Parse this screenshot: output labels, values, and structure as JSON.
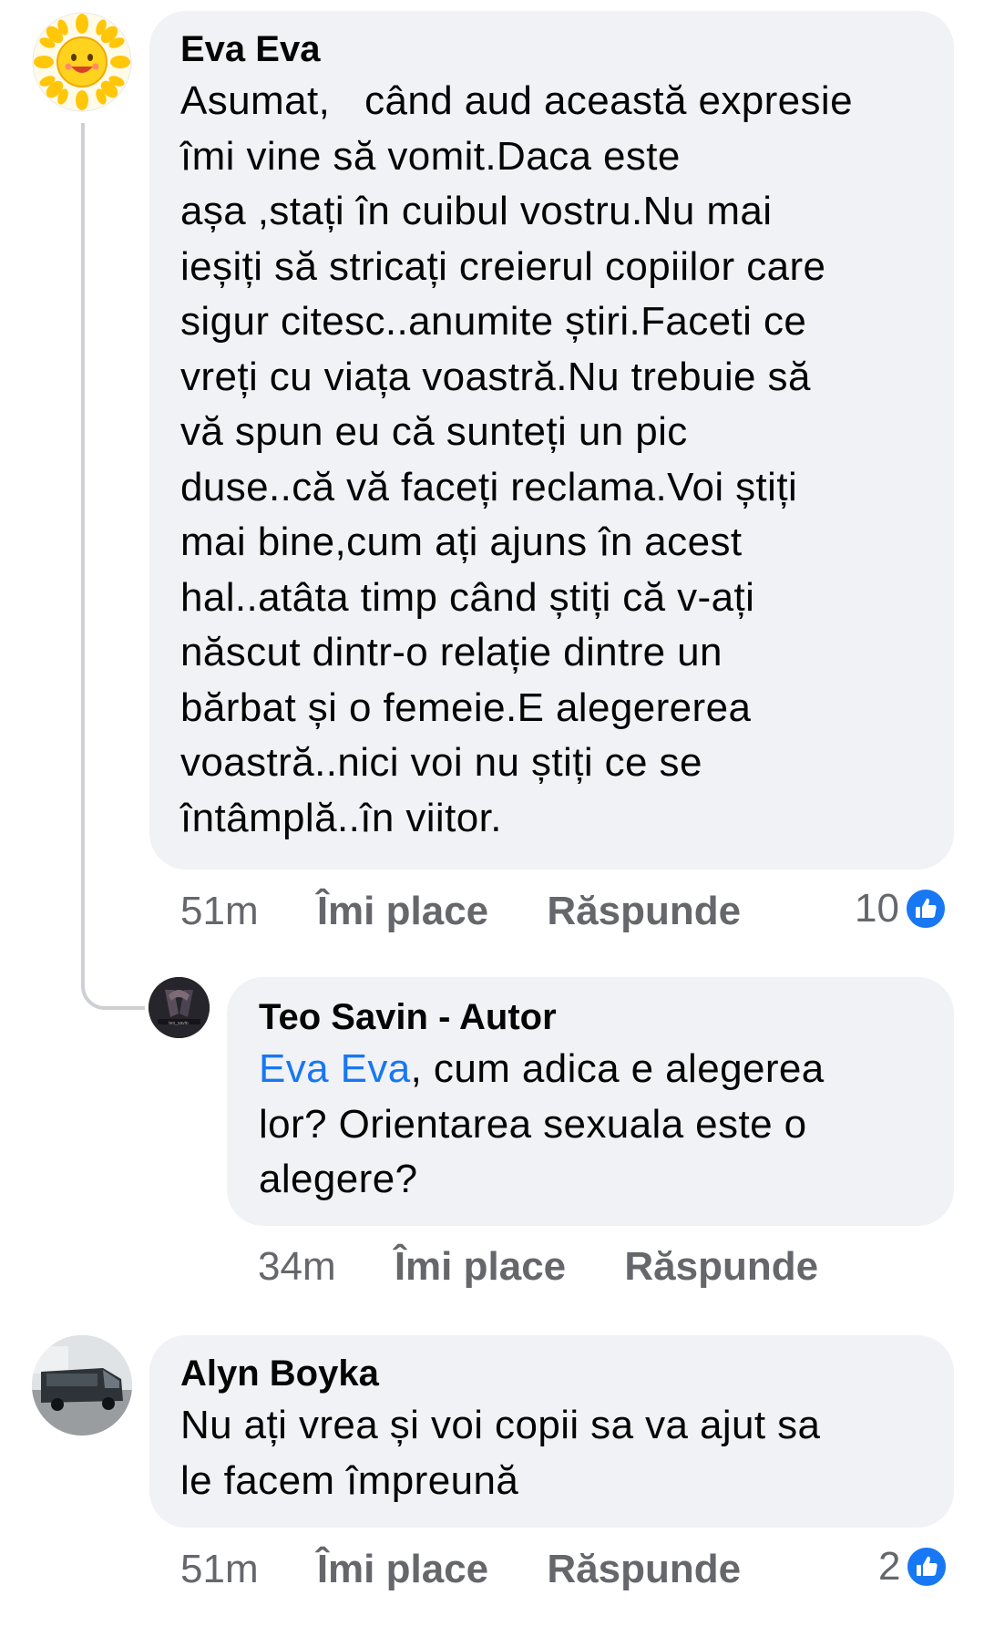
{
  "comments": [
    {
      "author": "Eva Eva",
      "avatar_icon": "smiling-sun-icon",
      "lines": [
        "Asumat,   când aud această expresie",
        "îmi vine să vomit.Daca este",
        "așa ,stați în cuibul vostru.Nu mai",
        "ieșiți să stricați creierul copiilor care",
        "sigur citesc..anumite știri.Faceti ce",
        "vreți cu viața voastră.Nu trebuie să",
        "vă spun eu că sunteți un pic",
        "duse..că vă faceți reclama.Voi știți",
        "mai bine,cum ați ajuns în acest",
        "hal..atâta timp când știți că v-ați",
        "născut dintr-o relație dintre un",
        "bărbat și o femeie.E alegererea",
        "voastră..nici voi nu știți ce se",
        "întâmplă..în viitor."
      ],
      "time": "51m",
      "like_label": "Îmi place",
      "reply_label": "Răspunde",
      "reaction_count": "10",
      "reaction_icon": "like-thumb-icon"
    },
    {
      "author": "Teo Savin - Autor",
      "avatar_icon": "profile-photo",
      "mention": "Eva Eva",
      "lines": [
        ", cum adica e alegerea",
        "lor? Orientarea sexuala este o",
        "alegere?"
      ],
      "time": "34m",
      "like_label": "Îmi place",
      "reply_label": "Răspunde"
    },
    {
      "author": "Alyn Boyka",
      "avatar_icon": "van-photo",
      "lines": [
        "Nu ați vrea și voi copii sa va ajut sa",
        "le facem împreună"
      ],
      "time": "51m",
      "like_label": "Îmi place",
      "reply_label": "Răspunde",
      "reaction_count": "2",
      "reaction_icon": "like-thumb-icon"
    }
  ],
  "colors": {
    "bubble": "#f0f2f5",
    "meta_text": "#65676b",
    "mention": "#1877f2",
    "like_blue": "#1877f2"
  }
}
